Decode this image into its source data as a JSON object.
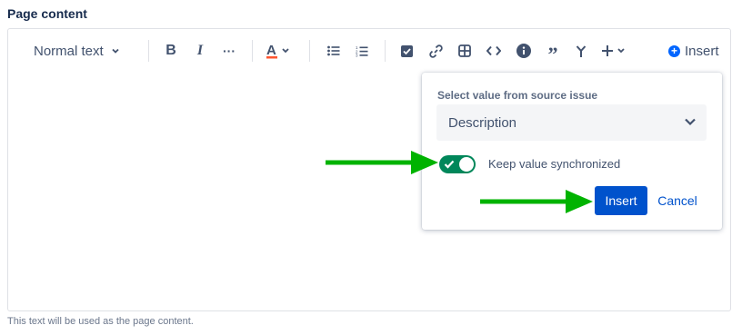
{
  "field": {
    "label": "Page content",
    "helper_text": "This text will be used as the page content."
  },
  "toolbar": {
    "text_style": "Normal text",
    "insert_label": "Insert",
    "icons": [
      "bold-icon",
      "italic-icon",
      "more-formatting-icon",
      "text-color-icon",
      "bullet-list-icon",
      "numbered-list-icon",
      "action-item-icon",
      "link-icon",
      "table-icon",
      "code-block-icon",
      "info-panel-icon",
      "quote-icon",
      "decision-icon",
      "plus-insert-icon"
    ]
  },
  "popup": {
    "select_label": "Select value from source issue",
    "select_value": "Description",
    "toggle_label": "Keep value synchronized",
    "toggle_on": true,
    "insert_button": "Insert",
    "cancel_link": "Cancel"
  },
  "colors": {
    "primary": "#0052cc",
    "toggle_on": "#00875a",
    "arrow": "#00b300",
    "text_color_bar": "#ff5630"
  }
}
